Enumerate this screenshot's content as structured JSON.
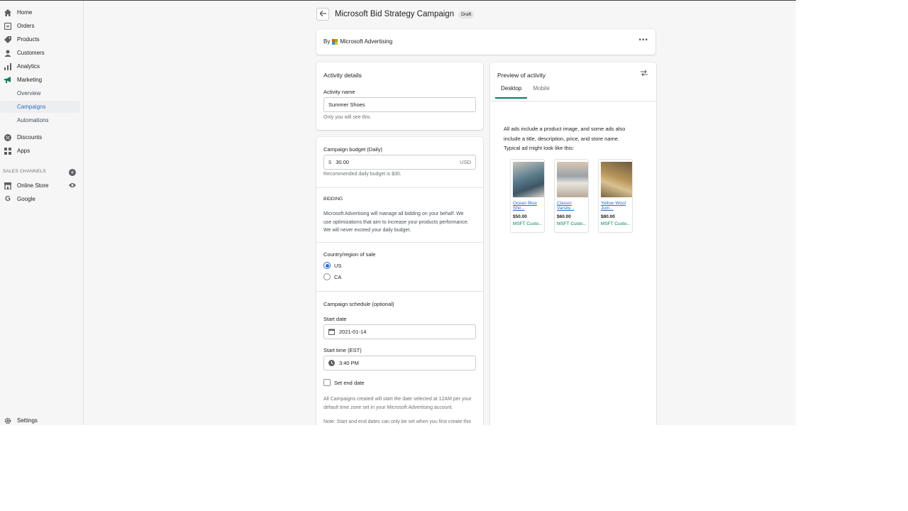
{
  "colors": {
    "accent": "#2c6ecb",
    "primary_green": "#008060",
    "ms_red": "#f25022",
    "ms_green": "#7fba00",
    "ms_blue": "#00a4ef",
    "ms_yellow": "#ffb900"
  },
  "sidebar": {
    "items": [
      {
        "label": "Home",
        "icon": "home-icon"
      },
      {
        "label": "Orders",
        "icon": "orders-icon"
      },
      {
        "label": "Products",
        "icon": "tag-icon"
      },
      {
        "label": "Customers",
        "icon": "person-icon"
      },
      {
        "label": "Analytics",
        "icon": "bar-chart-icon"
      },
      {
        "label": "Marketing",
        "icon": "megaphone-icon"
      }
    ],
    "marketing_sub": [
      {
        "label": "Overview"
      },
      {
        "label": "Campaigns",
        "active": true
      },
      {
        "label": "Automations"
      }
    ],
    "items2": [
      {
        "label": "Discounts",
        "icon": "discount-icon"
      },
      {
        "label": "Apps",
        "icon": "apps-icon"
      }
    ],
    "sales_channels_label": "SALES CHANNELS",
    "channels": [
      {
        "label": "Online Store",
        "icon": "store-icon"
      },
      {
        "label": "Google",
        "icon": "google-icon"
      }
    ],
    "settings": {
      "label": "Settings",
      "icon": "gear-icon"
    }
  },
  "header": {
    "title": "Microsoft Bid Strategy Campaign",
    "badge": "Draft"
  },
  "by_card": {
    "by_label": "By",
    "provider": "Microsoft Advertising"
  },
  "activity": {
    "heading": "Activity details",
    "name_label": "Activity name",
    "name_value": "Summer Shoes",
    "name_help": "Only you will see this."
  },
  "budget": {
    "label": "Campaign budget (Daily)",
    "prefix": "$",
    "value": "30.00",
    "suffix": "USD",
    "help": "Recommended daily budget is $30."
  },
  "bidding": {
    "heading": "BIDDING",
    "text_lines": [
      "Microsoft Advertising will manage all bidding on your behalf. We",
      "use optimizations that aim to increase your products performance.",
      "We will never exceed your daily budget."
    ]
  },
  "country": {
    "label": "Country/region of sale",
    "options": [
      {
        "label": "US",
        "selected": true
      },
      {
        "label": "CA",
        "selected": false
      }
    ]
  },
  "schedule": {
    "label": "Campaign schedule (optional)",
    "start_date_label": "Start date",
    "start_date_value": "2021-01-14",
    "start_time_label": "Start time (EST)",
    "start_time_value": "3:40 PM",
    "end_date_label": "Set end date",
    "note1_lines": [
      "All Campaigns created will start the date selected at 12AM per your",
      "default time zone set in your Microsoft Advertising account."
    ],
    "note2": "Note: Start and end dates can only be set when you first create this"
  },
  "preview": {
    "heading": "Preview of activity",
    "tabs": [
      "Desktop",
      "Mobile"
    ],
    "description_lines": [
      "All ads include a product image, and some ads also",
      "include a title, description, price, and store name.",
      "Typical ad might look like this:"
    ],
    "products": [
      {
        "name_l1": "Ocean Blue",
        "name_l2": "Shir...",
        "price": "$50.00",
        "store": "MSFT Custo...",
        "color_a": "#5a7b8c",
        "color_b": "#c8c5bd"
      },
      {
        "name_l1": "Classic",
        "name_l2": "Varsity...",
        "price": "$60.00",
        "store": "MSFT Custo...",
        "color_a": "#9aa3a8",
        "color_b": "#d9c7b4"
      },
      {
        "name_l1": "Yellow Wool",
        "name_l2": "Jum...",
        "price": "$80.00",
        "store": "MSFT Custo...",
        "color_a": "#b8955a",
        "color_b": "#6b5a3e"
      }
    ]
  }
}
